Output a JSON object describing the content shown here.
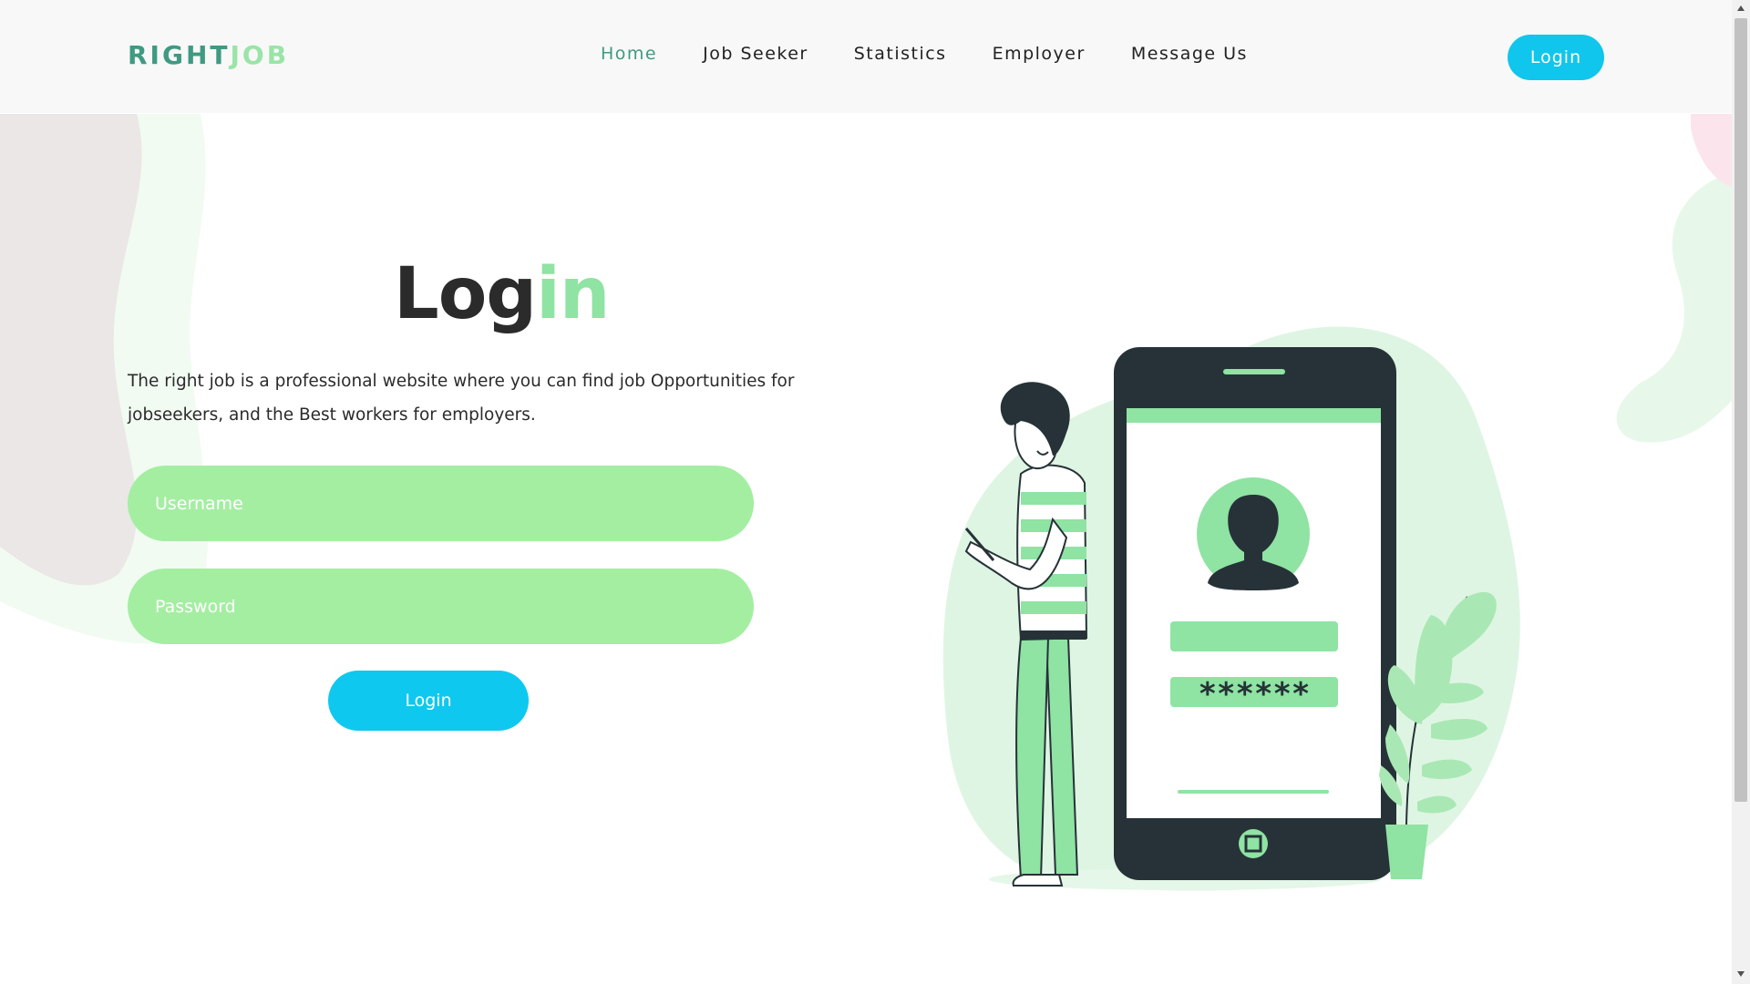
{
  "brand": {
    "part1": "RIGHT",
    "part2": "JOB"
  },
  "nav": {
    "items": [
      {
        "label": "Home",
        "active": true
      },
      {
        "label": "Job Seeker",
        "active": false
      },
      {
        "label": "Statistics",
        "active": false
      },
      {
        "label": "Employer",
        "active": false
      },
      {
        "label": "Message Us",
        "active": false
      }
    ],
    "login_label": "Login"
  },
  "main": {
    "title_part1": "Log",
    "title_part2": "in",
    "description": "The right job is a professional website where you can find job Opportunities for jobseekers, and the Best workers for employers.",
    "username_placeholder": "Username",
    "password_placeholder": "Password",
    "login_button": "Login"
  },
  "illustration": {
    "password_mask": "******"
  },
  "colors": {
    "brand_teal": "#3f9a82",
    "brand_green": "#9ae4a8",
    "button_blue": "#10c6ec",
    "field_green": "#a4eea2",
    "dark": "#263238"
  },
  "icons": [
    "avatar-icon",
    "phone-illustration",
    "person-illustration",
    "plant-illustration"
  ]
}
